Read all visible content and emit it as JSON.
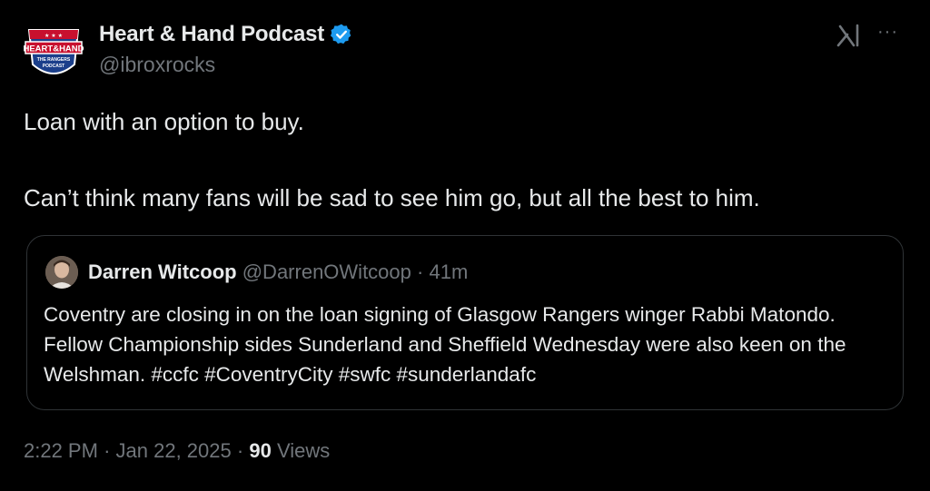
{
  "author": {
    "display_name": "Heart & Hand Podcast",
    "handle": "@ibroxrocks",
    "verified_icon": "verified-badge-icon",
    "avatar_text_line1": "HEART&HAND",
    "avatar_text_line2": "THE RANGERS",
    "avatar_text_line3": "PODCAST"
  },
  "header_actions": {
    "logo_icon": "grok-icon",
    "more_label": "···"
  },
  "tweet": {
    "line1": "Loan with an option to buy.",
    "line2": "Can’t think many fans will be sad to see him go, but all the best to him."
  },
  "quoted_tweet": {
    "display_name": "Darren Witcoop",
    "handle": "@DarrenOWitcoop",
    "separator": "·",
    "time_ago": "41m",
    "text": "Coventry are closing in on the loan signing of Glasgow Rangers winger Rabbi Matondo. Fellow Championship sides Sunderland and Sheffield Wednesday were also keen on the Welshman. #ccfc #CoventryCity #swfc #sunderlandafc"
  },
  "footer": {
    "time": "2:22 PM",
    "separator": "·",
    "date": "Jan 22, 2025",
    "views_count": "90",
    "views_label": "Views"
  },
  "colors": {
    "background": "#000000",
    "text_primary": "#e7e9ea",
    "text_secondary": "#71767b",
    "verified_blue": "#1d9bf0",
    "border": "#2f3336",
    "avatar_red": "#c8102e",
    "avatar_blue": "#1b3f8b"
  }
}
